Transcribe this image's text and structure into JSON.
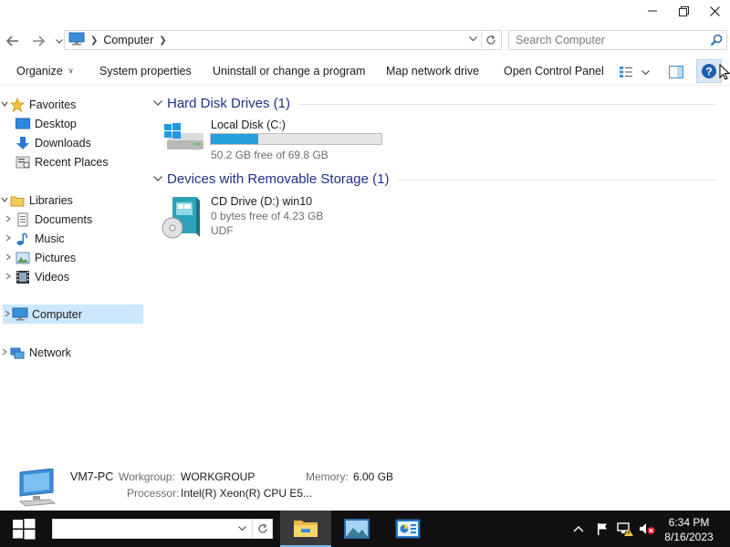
{
  "address": {
    "location": "Computer"
  },
  "search": {
    "placeholder": "Search Computer"
  },
  "toolbar": {
    "organize": "Organize",
    "system_properties": "System properties",
    "uninstall": "Uninstall or change a program",
    "map_drive": "Map network drive",
    "control_panel": "Open Control Panel"
  },
  "sidebar": {
    "favorites": "Favorites",
    "desktop": "Desktop",
    "downloads": "Downloads",
    "recent_places": "Recent Places",
    "libraries": "Libraries",
    "documents": "Documents",
    "music": "Music",
    "pictures": "Pictures",
    "videos": "Videos",
    "computer": "Computer",
    "network": "Network"
  },
  "groups": {
    "hard_disks": "Hard Disk Drives (1)",
    "removable": "Devices with Removable Storage (1)"
  },
  "drives": [
    {
      "name": "Local Disk (C:)",
      "free": "50.2 GB free of 69.8 GB",
      "used_fraction": 0.28
    },
    {
      "name": "CD Drive (D:) win10",
      "free": "0 bytes free of 4.23 GB",
      "fs": "UDF"
    }
  ],
  "details": {
    "name": "VM7-PC",
    "workgroup_label": "Workgroup:",
    "workgroup": "WORKGROUP",
    "memory_label": "Memory:",
    "memory": "6.00 GB",
    "processor_label": "Processor:",
    "processor": "Intel(R) Xeon(R) CPU E5..."
  },
  "taskbar": {
    "time": "6:34 PM",
    "date": "8/16/2023"
  },
  "colors": {
    "accent": "#26a0da",
    "selection": "#cce8ff",
    "group_title": "#1e3287",
    "taskbar": "#101010"
  }
}
